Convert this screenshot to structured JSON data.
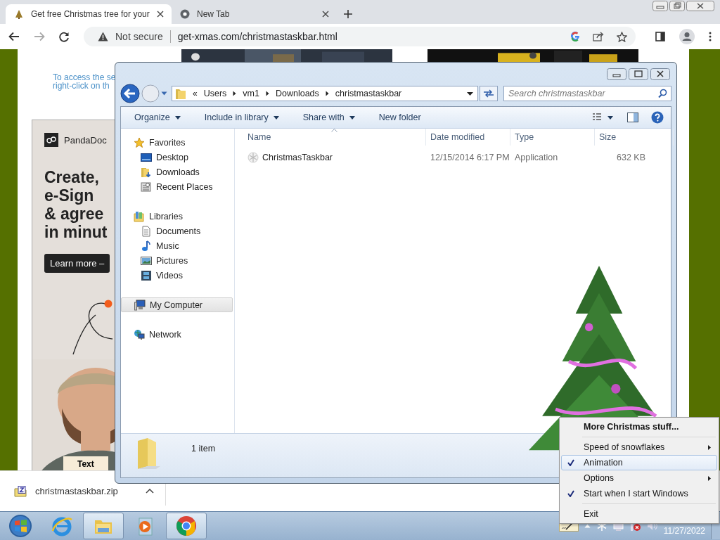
{
  "browser": {
    "tabs": [
      {
        "title": "Get free Christmas tree for your",
        "kind": "xmas",
        "selected": true
      },
      {
        "title": "New Tab",
        "kind": "chrome",
        "selected": false
      }
    ],
    "address": {
      "security": "Not secure",
      "url": "get-xmas.com/christmastaskbar.html"
    },
    "page": {
      "note_lines": [
        "To access the se",
        "right-click on th"
      ],
      "ad": {
        "brand": "PandaDoc",
        "headline": [
          "Create,",
          "e-Sign",
          "& agree",
          "in minut"
        ],
        "button": "Learn more –",
        "tag": "Text"
      }
    },
    "downloads": [
      {
        "file": "christmastaskbar.zip"
      }
    ]
  },
  "explorer": {
    "breadcrumb": [
      "Users",
      "vm1",
      "Downloads",
      "christmastaskbar"
    ],
    "overflow": "«",
    "search": {
      "placeholder": "Search christmastaskbar"
    },
    "toolbar": [
      {
        "label": "Organize",
        "dropdown": true
      },
      {
        "label": "Include in library",
        "dropdown": true
      },
      {
        "label": "Share with",
        "dropdown": true
      },
      {
        "label": "New folder",
        "dropdown": false
      }
    ],
    "nav": [
      {
        "label": "Favorites",
        "selected": false,
        "children": [
          {
            "label": "Desktop"
          },
          {
            "label": "Downloads"
          },
          {
            "label": "Recent Places"
          }
        ]
      },
      {
        "label": "Libraries",
        "selected": false,
        "children": [
          {
            "label": "Documents"
          },
          {
            "label": "Music"
          },
          {
            "label": "Pictures"
          },
          {
            "label": "Videos"
          }
        ]
      },
      {
        "label": "My Computer",
        "selected": true
      },
      {
        "label": "Network",
        "selected": false
      }
    ],
    "columns": [
      "Name",
      "Date modified",
      "Type",
      "Size"
    ],
    "rows": [
      {
        "name": "ChristmasTaskbar",
        "date": "12/15/2014 6:17 PM",
        "type": "Application",
        "size": "632 KB"
      }
    ],
    "status": "1 item"
  },
  "context_menu": [
    {
      "label": "More Christmas stuff...",
      "kind": "default",
      "checked": false,
      "submenu": false,
      "highlighted": false
    },
    {
      "kind": "separator"
    },
    {
      "label": "Speed of snowflakes",
      "kind": "item",
      "checked": false,
      "submenu": true,
      "highlighted": false
    },
    {
      "label": "Animation",
      "kind": "item",
      "checked": true,
      "submenu": false,
      "highlighted": true
    },
    {
      "label": "Options",
      "kind": "item",
      "checked": false,
      "submenu": true,
      "highlighted": false
    },
    {
      "label": "Start when I start Windows",
      "kind": "item",
      "checked": true,
      "submenu": false,
      "highlighted": false
    },
    {
      "kind": "separator"
    },
    {
      "label": "Exit",
      "kind": "item",
      "checked": false,
      "submenu": false,
      "highlighted": false
    }
  ],
  "taskbar": {
    "items": [
      {
        "kind": "start",
        "active": false
      },
      {
        "kind": "ie",
        "active": false
      },
      {
        "kind": "folder",
        "active": true
      },
      {
        "kind": "media",
        "active": false
      },
      {
        "kind": "chrome",
        "active": true
      }
    ],
    "clock": "11/27/2022"
  }
}
